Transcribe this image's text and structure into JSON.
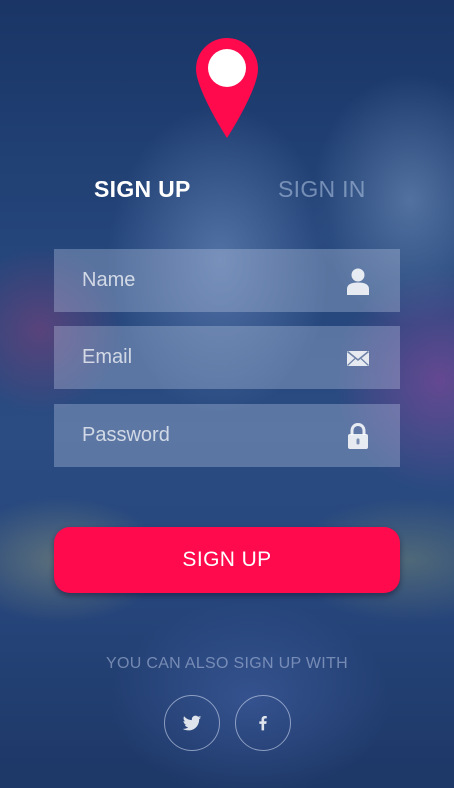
{
  "colors": {
    "accent": "#ff0a4d",
    "field_bg": "rgba(200,210,235,0.32)"
  },
  "logo": {
    "icon": "map-pin-icon"
  },
  "tabs": {
    "signup": "SIGN UP",
    "signin": "SIGN IN",
    "active": "signup"
  },
  "form": {
    "name": {
      "placeholder": "Name",
      "value": "",
      "icon": "user-icon"
    },
    "email": {
      "placeholder": "Email",
      "value": "",
      "icon": "envelope-icon"
    },
    "password": {
      "placeholder": "Password",
      "value": "",
      "icon": "lock-icon"
    }
  },
  "submit_label": "SIGN UP",
  "social": {
    "caption": "YOU CAN ALSO SIGN UP WITH",
    "providers": [
      {
        "name": "Twitter",
        "icon": "twitter-icon"
      },
      {
        "name": "Facebook",
        "icon": "facebook-icon"
      }
    ]
  }
}
